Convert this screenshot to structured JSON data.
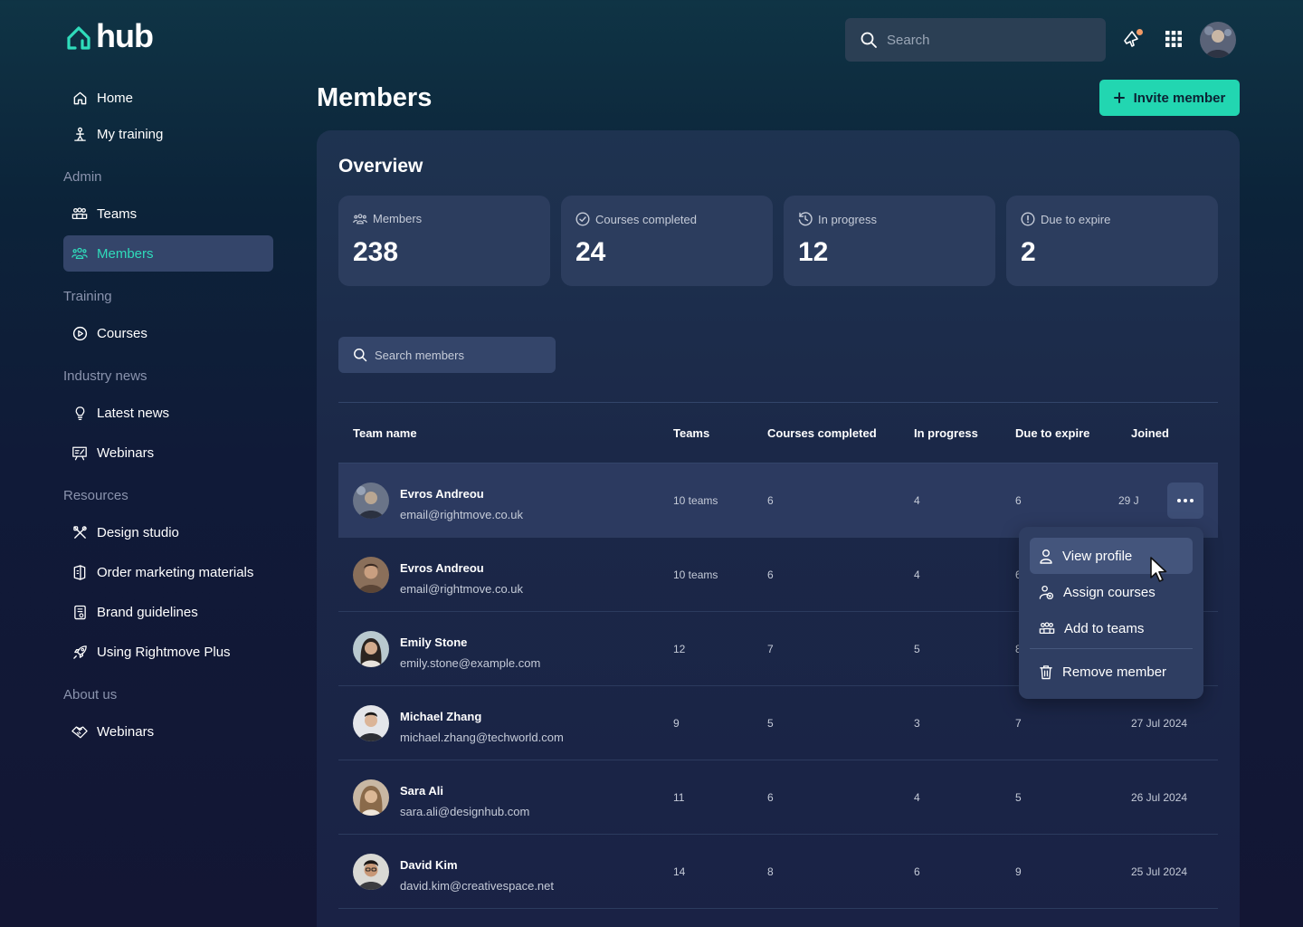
{
  "app": {
    "logo_text": "hub"
  },
  "header": {
    "search_placeholder": "Search",
    "notification_icon": "megaphone-icon",
    "apps_icon": "grid-icon"
  },
  "sidebar": {
    "home": "Home",
    "my_training": "My training",
    "admin_label": "Admin",
    "teams": "Teams",
    "members": "Members",
    "training_label": "Training",
    "courses": "Courses",
    "industry_label": "Industry news",
    "latest_news": "Latest news",
    "webinars": "Webinars",
    "resources_label": "Resources",
    "design_studio": "Design studio",
    "order_materials": "Order marketing materials",
    "brand_guidelines": "Brand guidelines",
    "using_plus": "Using Rightmove Plus",
    "about_label": "About us",
    "about_webinars": "Webinars"
  },
  "page": {
    "title": "Members",
    "invite_button": "Invite member"
  },
  "overview": {
    "title": "Overview",
    "stats": [
      {
        "label": "Members",
        "value": "238",
        "icon": "members-icon"
      },
      {
        "label": "Courses completed",
        "value": "24",
        "icon": "check-circle-icon"
      },
      {
        "label": "In progress",
        "value": "12",
        "icon": "clock-icon"
      },
      {
        "label": "Due to expire",
        "value": "2",
        "icon": "alert-circle-icon"
      }
    ]
  },
  "members_search": {
    "placeholder": "Search members"
  },
  "table": {
    "headers": [
      "Team name",
      "Teams",
      "Courses completed",
      "In progress",
      "Due to expire",
      "Joined"
    ],
    "rows": [
      {
        "name": "Evros Andreou",
        "email": "email@rightmove.co.uk",
        "teams": "10 teams",
        "completed": "6",
        "in_progress": "4",
        "due": "6",
        "joined": "29 J"
      },
      {
        "name": "Evros Andreou",
        "email": "email@rightmove.co.uk",
        "teams": "10 teams",
        "completed": "6",
        "in_progress": "4",
        "due": "6",
        "joined": ""
      },
      {
        "name": "Emily Stone",
        "email": "emily.stone@example.com",
        "teams": "12",
        "completed": "7",
        "in_progress": "5",
        "due": "8",
        "joined": ""
      },
      {
        "name": "Michael Zhang",
        "email": "michael.zhang@techworld.com",
        "teams": "9",
        "completed": "5",
        "in_progress": "3",
        "due": "7",
        "joined": "27 Jul 2024"
      },
      {
        "name": "Sara Ali",
        "email": "sara.ali@designhub.com",
        "teams": "11",
        "completed": "6",
        "in_progress": "4",
        "due": "5",
        "joined": "26 Jul 2024"
      },
      {
        "name": "David Kim",
        "email": "david.kim@creativespace.net",
        "teams": "14",
        "completed": "8",
        "in_progress": "6",
        "due": "9",
        "joined": "25 Jul 2024"
      }
    ]
  },
  "menu": {
    "view_profile": "View profile",
    "assign_courses": "Assign courses",
    "add_to_teams": "Add to teams",
    "remove_member": "Remove member"
  },
  "colors": {
    "accent": "#22d6b1",
    "active_text": "#2fdcbb",
    "panel": "#1b2848",
    "card": "#2c3d5e"
  }
}
